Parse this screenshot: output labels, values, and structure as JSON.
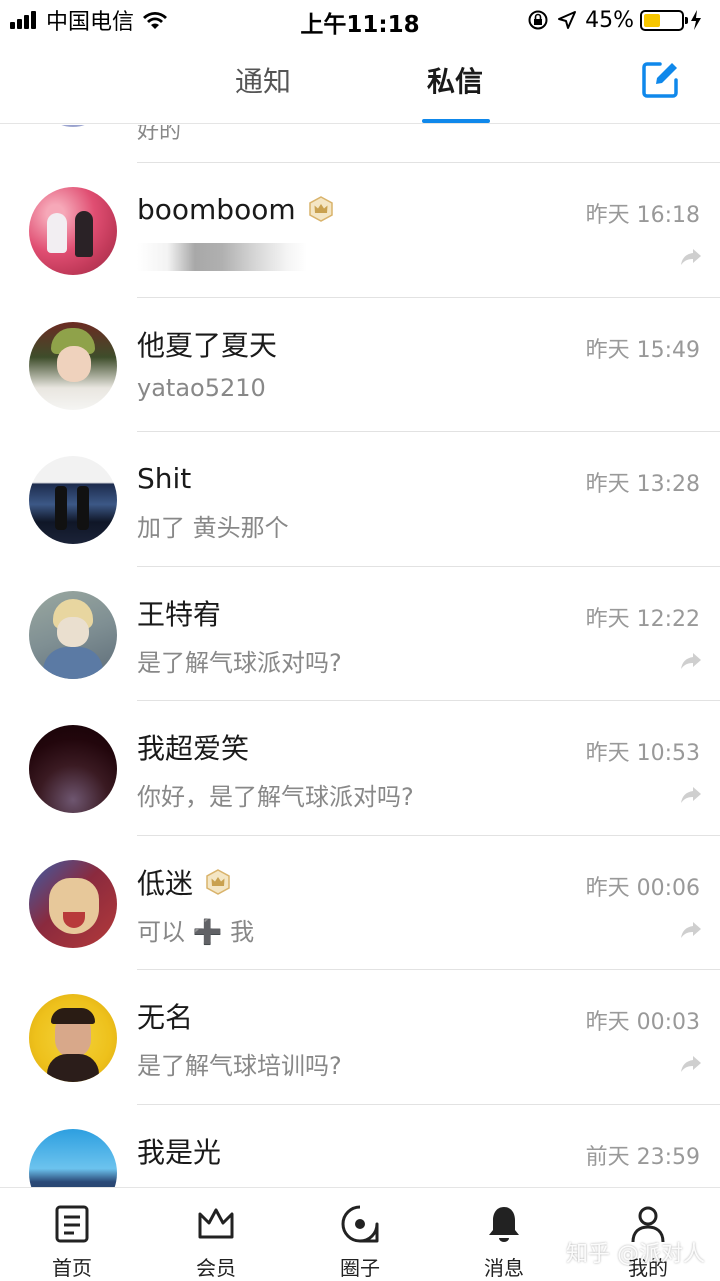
{
  "status_bar": {
    "carrier": "中国电信",
    "time": "上午11:18",
    "battery_percent": "45%",
    "battery_level": 0.45,
    "icons": [
      "signal-icon",
      "wifi-icon",
      "orientation-lock-icon",
      "location-icon",
      "battery-icon",
      "charging-icon"
    ]
  },
  "header": {
    "tabs": [
      {
        "label": "通知",
        "active": false
      },
      {
        "label": "私信",
        "active": true
      }
    ],
    "compose_icon": "compose-icon",
    "accent_color": "#0f88eb"
  },
  "messages": {
    "partial_top": {
      "preview": "好的"
    },
    "items": [
      {
        "name": "boomboom",
        "badge": "crown-icon",
        "time": "昨天 16:18",
        "preview": "",
        "preview_blurred": true,
        "share": true
      },
      {
        "name": "他夏了夏天",
        "time": "昨天 15:49",
        "preview": "yatao5210",
        "share": false
      },
      {
        "name": "Shit",
        "time": "昨天 13:28",
        "preview": "加了 黄头那个",
        "share": false
      },
      {
        "name": "王特宥",
        "time": "昨天 12:22",
        "preview": "是了解气球派对吗?",
        "share": true
      },
      {
        "name": "我超爱笑",
        "time": "昨天 10:53",
        "preview": "你好，是了解气球派对吗?",
        "share": true
      },
      {
        "name": "低迷",
        "badge": "crown-icon",
        "time": "昨天 00:06",
        "preview": "可以 ➕ 我",
        "share": true
      },
      {
        "name": "无名",
        "time": "昨天 00:03",
        "preview": "是了解气球培训吗?",
        "share": true
      },
      {
        "name": "我是光",
        "time": "前天 23:59",
        "preview": "",
        "share": false
      }
    ]
  },
  "tabbar": {
    "items": [
      {
        "label": "首页",
        "icon": "document-icon"
      },
      {
        "label": "会员",
        "icon": "crown-icon"
      },
      {
        "label": "圈子",
        "icon": "circle-icon"
      },
      {
        "label": "消息",
        "icon": "bell-icon"
      },
      {
        "label": "我的",
        "icon": "person-icon"
      }
    ]
  },
  "watermark": "知乎 @派对人"
}
